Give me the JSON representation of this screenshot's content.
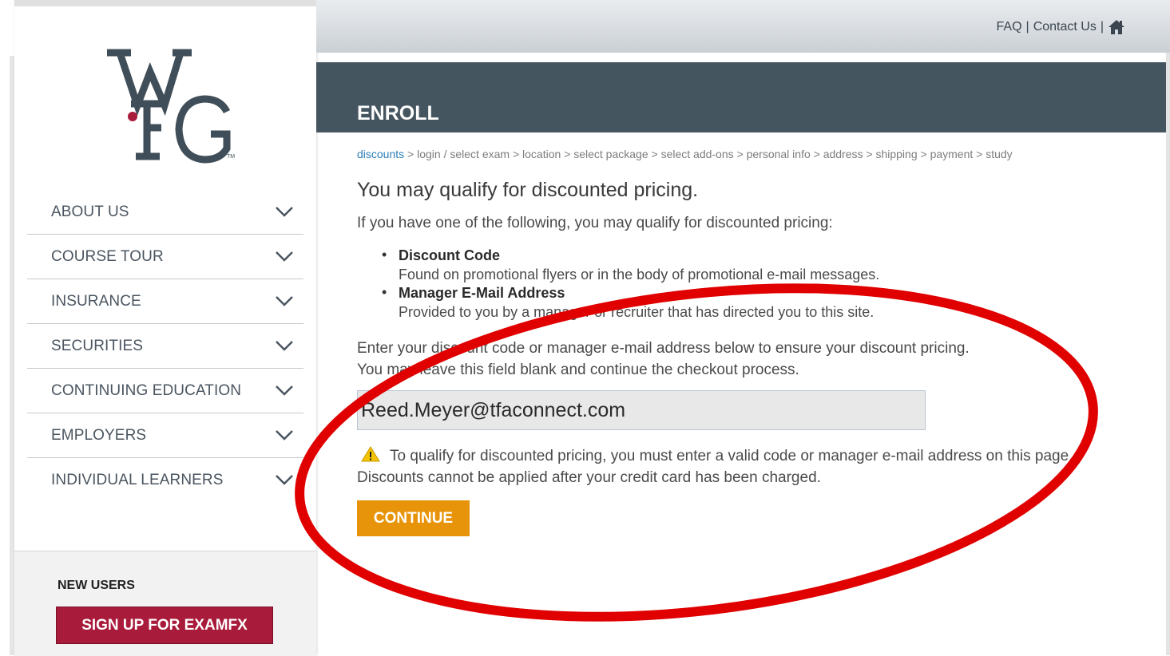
{
  "header": {
    "faq_label": "FAQ",
    "separator": "|",
    "contact_label": "Contact Us",
    "home_icon": "home-icon"
  },
  "logo": {
    "text": "WFG",
    "trademark": "TM"
  },
  "sidebar": {
    "items": [
      {
        "label": "ABOUT US"
      },
      {
        "label": "COURSE TOUR"
      },
      {
        "label": "INSURANCE"
      },
      {
        "label": "SECURITIES"
      },
      {
        "label": "CONTINUING EDUCATION"
      },
      {
        "label": "EMPLOYERS"
      },
      {
        "label": "INDIVIDUAL LEARNERS"
      }
    ],
    "new_users_title": "NEW USERS",
    "signup_label": "SIGN UP FOR EXAMFX"
  },
  "banner": {
    "title": "ENROLL"
  },
  "breadcrumb": {
    "current": "discounts",
    "rest": " > login / select exam > location > select package > select add-ons > personal info > address > shipping > payment > study"
  },
  "main": {
    "heading": "You may qualify for discounted pricing.",
    "intro": "If you have one of the following, you may qualify for discounted pricing:",
    "options": [
      {
        "name": "Discount Code",
        "desc": "Found on promotional flyers or in the body of promotional e-mail messages."
      },
      {
        "name": "Manager E-Mail Address",
        "desc": "Provided to you by a manager or recruiter that has directed you to this site."
      }
    ],
    "instructions_line1": "Enter your discount code or manager e-mail address below to ensure your discount pricing.",
    "instructions_line2": "You may leave this field blank and continue the checkout process.",
    "input_value": "Reed.Meyer@tfaconnect.com",
    "warning_text": "To qualify for discounted pricing, you must enter a valid code or manager e-mail address on this page. Discounts cannot be applied after your credit card has been charged.",
    "continue_label": "CONTINUE"
  },
  "colors": {
    "banner": "#455560",
    "signup_button": "#a91b3b",
    "continue_button": "#e8940b",
    "link": "#2c7fb8",
    "annotation": "#e00000"
  }
}
